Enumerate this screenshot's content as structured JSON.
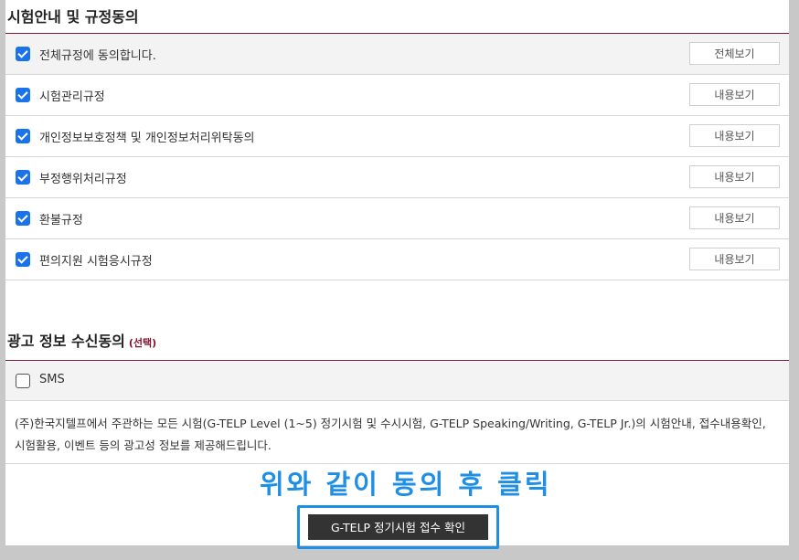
{
  "terms": {
    "title": "시험안내 및 규정동의",
    "rows": [
      {
        "label": "전체규정에 동의합니다.",
        "button": "전체보기",
        "checked": true
      },
      {
        "label": "시험관리규정",
        "button": "내용보기",
        "checked": true
      },
      {
        "label": "개인정보보호정책 및 개인정보처리위탁동의",
        "button": "내용보기",
        "checked": true
      },
      {
        "label": "부정행위처리규정",
        "button": "내용보기",
        "checked": true
      },
      {
        "label": "환불규정",
        "button": "내용보기",
        "checked": true
      },
      {
        "label": "편의지원 시험응시규정",
        "button": "내용보기",
        "checked": true
      }
    ]
  },
  "ads": {
    "title": "광고 정보 수신동의",
    "optional": "(선택)",
    "sms_label": "SMS",
    "sms_checked": false,
    "description": "(주)한국지텔프에서 주관하는 모든 시험(G-TELP Level (1~5) 정기시험 및 수시시험, G-TELP Speaking/Writing, G-TELP Jr.)의 시험안내, 접수내용확인, 시험활용, 이벤트 등의 광고성 정보를 제공해드립니다."
  },
  "annotation": "위와 같이 동의 후 클릭",
  "submit_button": "G-TELP 정기시험 접수 확인",
  "colors": {
    "accent_blue": "#1f8fe5",
    "checkbox_blue": "#1a73e8",
    "divider_maroon": "#7a1a35",
    "button_dark": "#333333"
  }
}
